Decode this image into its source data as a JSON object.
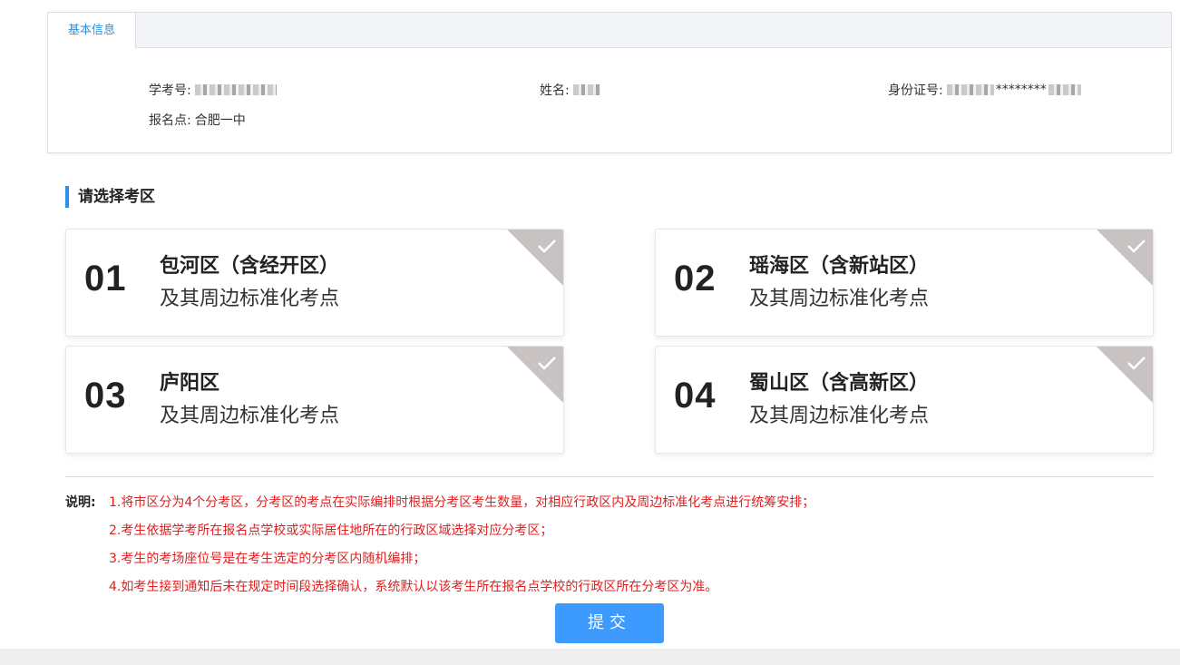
{
  "info": {
    "tab_label": "基本信息",
    "student_id_label": "学考号:",
    "name_label": "姓名:",
    "id_card_label": "身份证号:",
    "id_card_stars": "********",
    "registration_label": "报名点:",
    "registration_value": "合肥一中"
  },
  "section": {
    "title": "请选择考区"
  },
  "districts": [
    {
      "num": "01",
      "name": "包河区（含经开区）",
      "sub": "及其周边标准化考点"
    },
    {
      "num": "02",
      "name": "瑶海区（含新站区）",
      "sub": "及其周边标准化考点"
    },
    {
      "num": "03",
      "name": "庐阳区",
      "sub": "及其周边标准化考点"
    },
    {
      "num": "04",
      "name": "蜀山区（含高新区）",
      "sub": "及其周边标准化考点"
    }
  ],
  "notes": {
    "label": "说明:",
    "items": [
      "1.将市区分为4个分考区，分考区的考点在实际编排时根据分考区考生数量，对相应行政区内及周边标准化考点进行统筹安排；",
      "2.考生依据学考所在报名点学校或实际居住地所在的行政区域选择对应分考区；",
      "3.考生的考场座位号是在考生选定的分考区内随机编排；",
      "4.如考生接到通知后未在规定时间段选择确认，系统默认以该考生所在报名点学校的行政区所在分考区为准。"
    ]
  },
  "submit": {
    "label": "提交"
  },
  "colors": {
    "accent": "#2b8ff0",
    "tab_text": "#2f8fd8",
    "button": "#3d9bff",
    "note_text": "#e02020",
    "corner": "#c9c2c2"
  }
}
